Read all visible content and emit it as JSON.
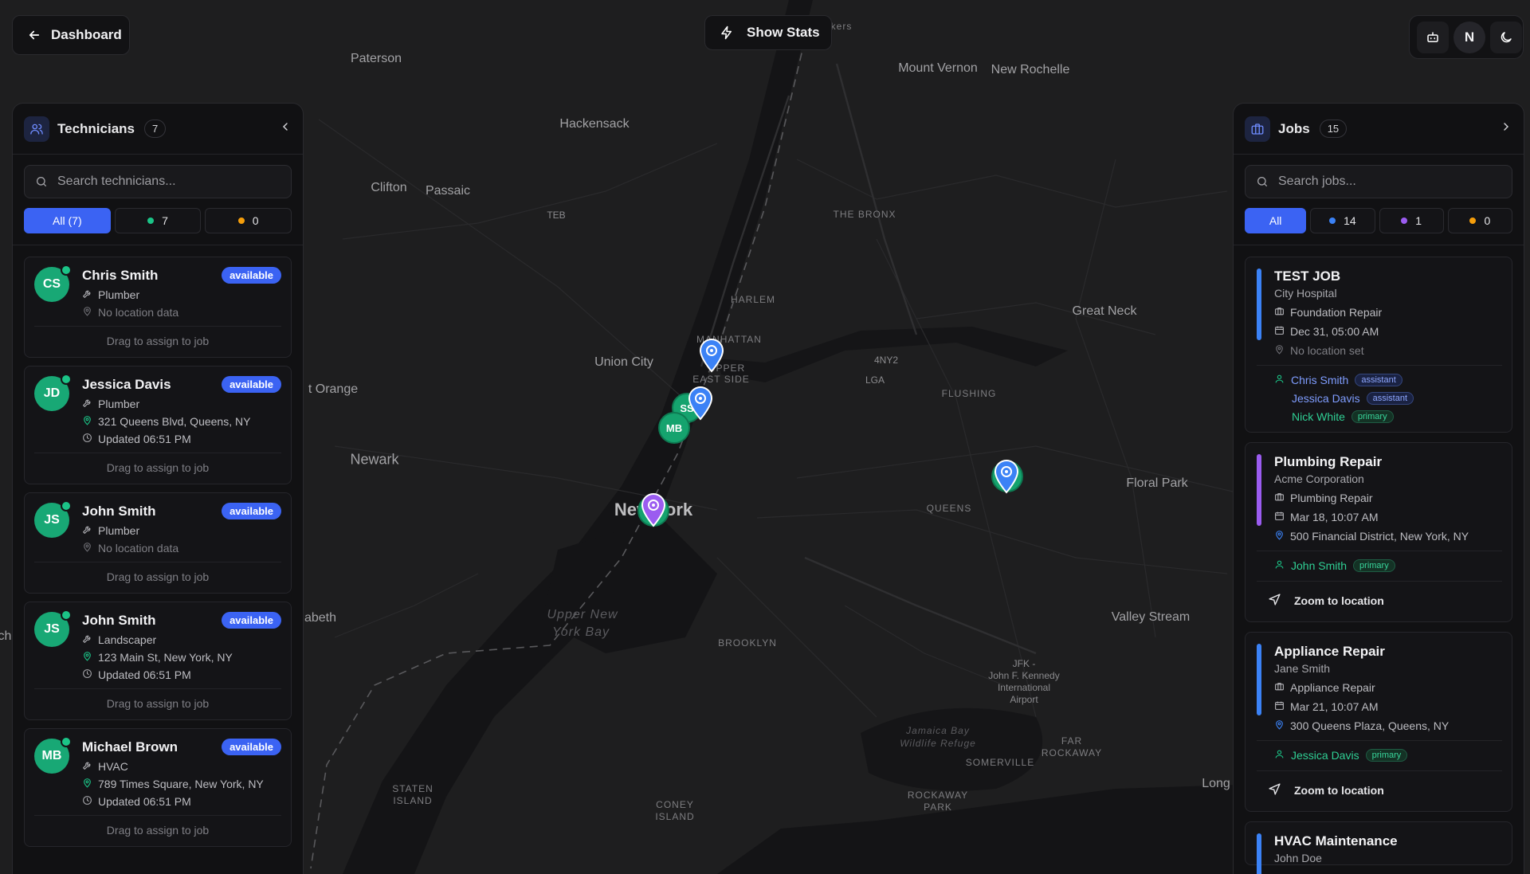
{
  "top": {
    "dashboard_label": "Dashboard",
    "stats_label": "Show Stats",
    "avatar_initial": "N"
  },
  "map": {
    "labels": {
      "yonkers": "kers",
      "paterson": "Paterson",
      "mount_vernon": "Mount Vernon",
      "new_rochelle": "New Rochelle",
      "hackensack": "Hackensack",
      "clifton": "Clifton",
      "passaic": "Passaic",
      "teb": "TEB",
      "bronx": "THE BRONX",
      "harlem": "HARLEM",
      "manhattan": "MANHATTAN",
      "upper_east": "UPPER",
      "east_side": "EAST SIDE",
      "union_city": "Union City",
      "east_orange": "t Orange",
      "newark": "Newark",
      "new_york": "New York",
      "ny4": "4NY2",
      "lga": "LGA",
      "flushing": "FLUSHING",
      "great_neck": "Great Neck",
      "floral_park": "Floral Park",
      "queens": "QUEENS",
      "valley_stream": "Valley Stream",
      "elizabeth": "abeth",
      "upper_ny_bay_1": "Upper New",
      "upper_ny_bay_2": "York Bay",
      "brooklyn": "BROOKLYN",
      "jfk_1": "JFK -",
      "jfk_2": "John F. Kennedy",
      "jfk_3": "International",
      "jfk_4": "Airport",
      "jamaica_1": "Jamaica Bay",
      "jamaica_2": "Wildlife Refuge",
      "somerville": "SOMERVILLE",
      "far_rock_1": "FAR",
      "far_rock_2": "ROCKAWAY",
      "rockaway_1": "ROCKAWAY",
      "rockaway_2": "PARK",
      "staten_1": "STATEN",
      "staten_2": "ISLAND",
      "coney_1": "CONEY",
      "coney_2": "ISLAND",
      "long": "Long",
      "ch": "ch"
    },
    "markers": [
      {
        "initials": "SS"
      },
      {
        "initials": "MB"
      }
    ]
  },
  "technicians": {
    "title": "Technicians",
    "count": "7",
    "search_placeholder": "Search technicians...",
    "filters": {
      "all": "All (7)",
      "green": "7",
      "orange": "0"
    },
    "drag_label": "Drag to assign to job",
    "items": [
      {
        "initials": "CS",
        "name": "Chris Smith",
        "status": "available",
        "role": "Plumber",
        "location": "No location data",
        "updated": ""
      },
      {
        "initials": "JD",
        "name": "Jessica Davis",
        "status": "available",
        "role": "Plumber",
        "location": "321 Queens Blvd, Queens, NY",
        "updated": "Updated 06:51 PM"
      },
      {
        "initials": "JS",
        "name": "John Smith",
        "status": "available",
        "role": "Plumber",
        "location": "No location data",
        "updated": ""
      },
      {
        "initials": "JS",
        "name": "John Smith",
        "status": "available",
        "role": "Landscaper",
        "location": "123 Main St, New York, NY",
        "updated": "Updated 06:51 PM"
      },
      {
        "initials": "MB",
        "name": "Michael Brown",
        "status": "available",
        "role": "HVAC",
        "location": "789 Times Square, New York, NY",
        "updated": "Updated 06:51 PM"
      }
    ]
  },
  "jobs": {
    "title": "Jobs",
    "count": "15",
    "search_placeholder": "Search jobs...",
    "filters": {
      "all": "All",
      "blue": "14",
      "purple": "1",
      "orange": "0"
    },
    "zoom_label": "Zoom to location",
    "items": [
      {
        "title": "TEST JOB",
        "customer": "City Hospital",
        "type": "Foundation Repair",
        "date": "Dec 31, 05:00 AM",
        "location": "No location set",
        "stripe": "#3b82f6",
        "assignees": [
          {
            "name": "Chris Smith",
            "role": "assistant"
          },
          {
            "name": "Jessica Davis",
            "role": "assistant"
          },
          {
            "name": "Nick White",
            "role": "primary"
          }
        ]
      },
      {
        "title": "Plumbing Repair",
        "customer": "Acme Corporation",
        "type": "Plumbing Repair",
        "date": "Mar 18, 10:07 AM",
        "location": "500 Financial District, New York, NY",
        "stripe": "#9b5cf0",
        "assignees": [
          {
            "name": "John Smith",
            "role": "primary"
          }
        ]
      },
      {
        "title": "Appliance Repair",
        "customer": "Jane Smith",
        "type": "Appliance Repair",
        "date": "Mar 21, 10:07 AM",
        "location": "300 Queens Plaza, Queens, NY",
        "stripe": "#3b82f6",
        "assignees": [
          {
            "name": "Jessica Davis",
            "role": "primary"
          }
        ]
      },
      {
        "title": "HVAC Maintenance",
        "customer": "John Doe",
        "stripe": "#3b82f6"
      }
    ]
  },
  "colors": {
    "accent": "#3b63f3",
    "green": "#18a875",
    "purple": "#9b5cf0",
    "orange": "#f59e0b"
  }
}
